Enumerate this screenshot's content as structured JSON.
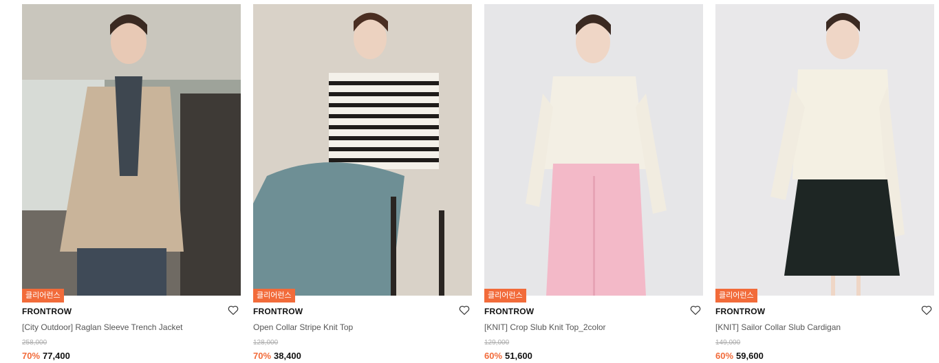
{
  "products": [
    {
      "badge": "클리어런스",
      "brand": "FRONTROW",
      "name": "[City Outdoor] Raglan Sleeve Trench Jacket",
      "original_price": "258,000",
      "discount": "70%",
      "sale_price": "77,400"
    },
    {
      "badge": "클리어런스",
      "brand": "FRONTROW",
      "name": "Open Collar Stripe Knit Top",
      "original_price": "128,000",
      "discount": "70%",
      "sale_price": "38,400"
    },
    {
      "badge": "클리어런스",
      "brand": "FRONTROW",
      "name": "[KNIT] Crop Slub Knit Top_2color",
      "original_price": "129,000",
      "discount": "60%",
      "sale_price": "51,600"
    },
    {
      "badge": "클리어런스",
      "brand": "FRONTROW",
      "name": "[KNIT] Sailor Collar Slub Cardigan",
      "original_price": "149,000",
      "discount": "60%",
      "sale_price": "59,600"
    }
  ],
  "colors": {
    "badge": "#f26b3a",
    "discount": "#f26b3a"
  },
  "icons": {
    "wishlist": "heart-outline-icon"
  }
}
